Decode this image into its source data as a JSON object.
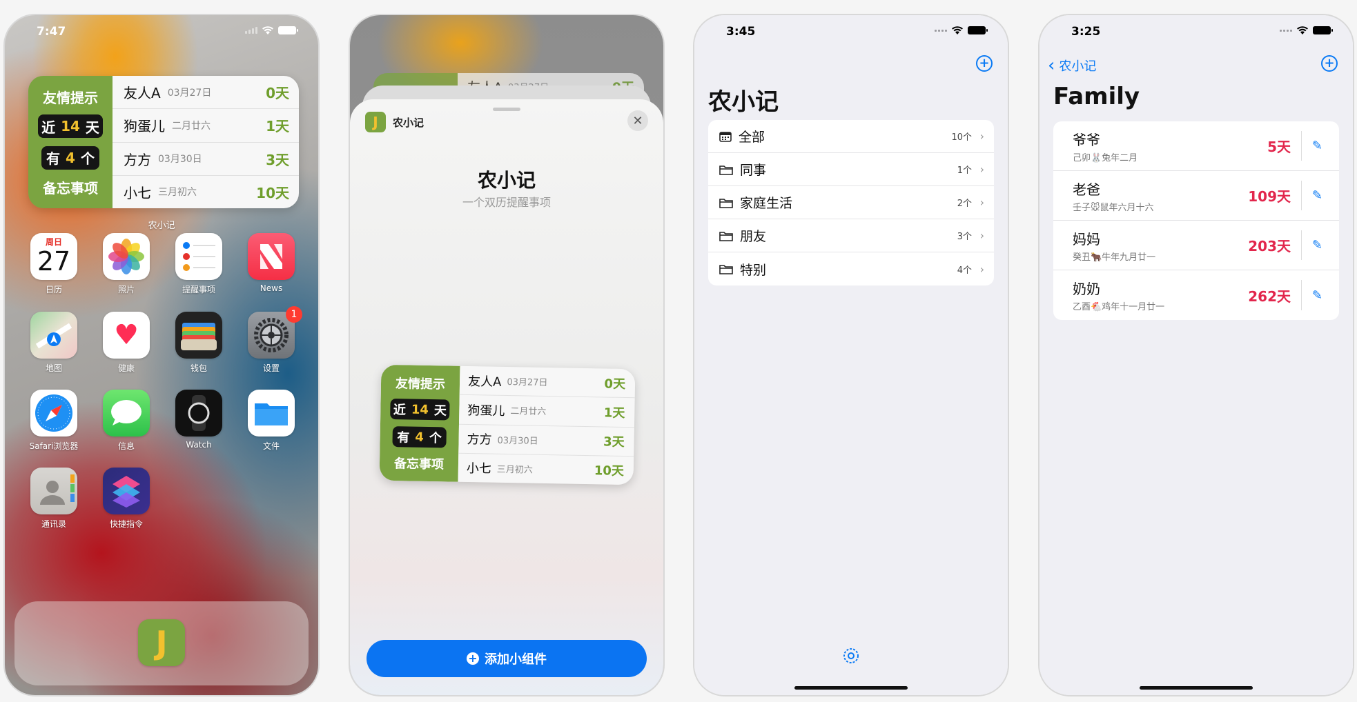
{
  "phone1": {
    "time": "7:47",
    "widget": {
      "reminder_title": "友情提示",
      "near_prefix": "近",
      "near_num": "14",
      "near_suffix": "天",
      "have_prefix": "有",
      "have_num": "4",
      "have_suffix": "个",
      "memo": "备忘事项",
      "rows": [
        {
          "name": "友人A",
          "date": "03月27日",
          "days": "0天"
        },
        {
          "name": "狗蛋儿",
          "date": "二月廿六",
          "days": "1天"
        },
        {
          "name": "方方",
          "date": "03月30日",
          "days": "3天"
        },
        {
          "name": "小七",
          "date": "三月初六",
          "days": "10天"
        }
      ],
      "caption": "农小记"
    },
    "apps": [
      {
        "label": "日历",
        "weekday": "周日",
        "day": "27"
      },
      {
        "label": "照片"
      },
      {
        "label": "提醒事项"
      },
      {
        "label": "News"
      },
      {
        "label": "地图"
      },
      {
        "label": "健康"
      },
      {
        "label": "钱包"
      },
      {
        "label": "设置",
        "badge": "1"
      },
      {
        "label": "Safari浏览器"
      },
      {
        "label": "信息"
      },
      {
        "label": "Watch"
      },
      {
        "label": "文件"
      },
      {
        "label": "通讯录"
      },
      {
        "label": "快捷指令"
      }
    ],
    "dock_app_letter": "J"
  },
  "phone2": {
    "behind_row": {
      "name": "友人A",
      "date": "03月27日",
      "days": "0天"
    },
    "app_name": "农小记",
    "title": "农小记",
    "subtitle": "一个双历提醒事项",
    "close_glyph": "✕",
    "add_button": "添加小组件",
    "add_glyph": "+"
  },
  "phone3": {
    "time": "3:45",
    "title": "农小记",
    "rows": [
      {
        "label": "全部",
        "count": "10个"
      },
      {
        "label": "同事",
        "count": "1个"
      },
      {
        "label": "家庭生活",
        "count": "2个"
      },
      {
        "label": "朋友",
        "count": "3个"
      },
      {
        "label": "特别",
        "count": "4个"
      }
    ]
  },
  "phone4": {
    "time": "3:25",
    "back": "农小记",
    "title": "Family",
    "rows": [
      {
        "name": "爷爷",
        "sub": "己卯🐰兔年二月",
        "days": "5天"
      },
      {
        "name": "老爸",
        "sub": "壬子🐭鼠年六月十六",
        "days": "109天"
      },
      {
        "name": "妈妈",
        "sub": "癸丑🐂牛年九月廿一",
        "days": "203天"
      },
      {
        "name": "奶奶",
        "sub": "乙酉🐔鸡年十一月廿一",
        "days": "262天"
      }
    ]
  },
  "colors": {
    "accent_green": "#7ba441",
    "days_red": "#e2264c",
    "ios_blue": "#0a7af4",
    "add_blue": "#0b74f2"
  }
}
